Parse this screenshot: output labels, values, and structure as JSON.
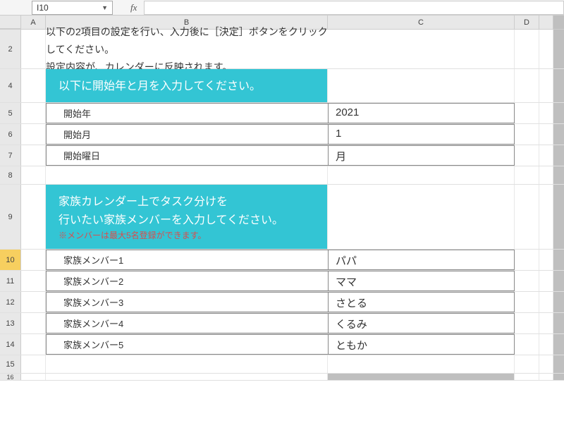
{
  "nameBox": "I10",
  "fxLabel": "fx",
  "columns": [
    "A",
    "B",
    "C",
    "D"
  ],
  "intro": {
    "line1": "以下の2項目の設定を行い、入力後に［決定］ボタンをクリックしてください。",
    "line2": "設定内容が、カレンダーに反映されます。"
  },
  "banner1": {
    "text": "以下に開始年と月を入力してください。"
  },
  "startTable": {
    "rows": [
      {
        "label": "開始年",
        "value": "2021"
      },
      {
        "label": "開始月",
        "value": "1"
      },
      {
        "label": "開始曜日",
        "value": "月"
      }
    ]
  },
  "banner2": {
    "line1": "家族カレンダー上でタスク分けを",
    "line2": "行いたい家族メンバーを入力してください。",
    "note": "※メンバーは最大5名登録ができます。"
  },
  "memberTable": {
    "rows": [
      {
        "label": "家族メンバー1",
        "value": "パパ"
      },
      {
        "label": "家族メンバー2",
        "value": "ママ"
      },
      {
        "label": "家族メンバー3",
        "value": "さとる"
      },
      {
        "label": "家族メンバー4",
        "value": "くるみ"
      },
      {
        "label": "家族メンバー5",
        "value": "ともか"
      }
    ]
  },
  "rowNumbers": [
    "2",
    "4",
    "5",
    "6",
    "7",
    "8",
    "9",
    "10",
    "11",
    "12",
    "13",
    "14",
    "15",
    "16"
  ],
  "selectedRow": "10"
}
